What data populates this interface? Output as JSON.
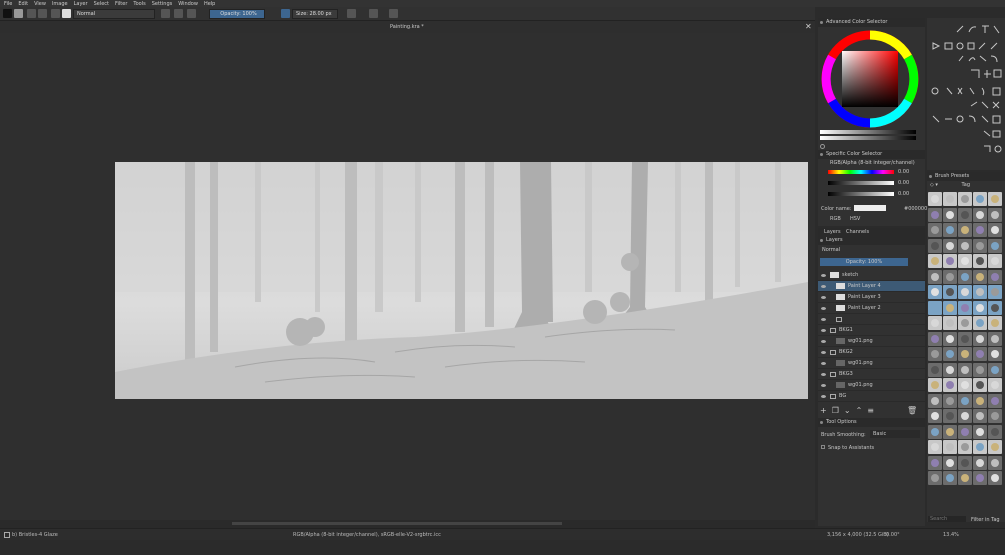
{
  "menu": [
    "File",
    "Edit",
    "View",
    "Image",
    "Layer",
    "Select",
    "Filter",
    "Tools",
    "Settings",
    "Window",
    "Help"
  ],
  "toolbar": {
    "blend_mode": "Normal",
    "opacity": "Opacity: 100%",
    "size": "Size: 28.00 px"
  },
  "document": {
    "tab_title": "Painting.kra *"
  },
  "status": {
    "brush": "b) Bristles-4 Glaze",
    "color_space": "RGB/Alpha (8-bit integer/channel), sRGB-elle-V2-srgbtrc.icc",
    "dimensions": "3,156 x 4,000 (32.5 GiB)",
    "rotation": "0.00°",
    "zoom": "13.4%"
  },
  "dockers": {
    "advanced_color": "Advanced Color Selector",
    "specific_color": {
      "title": "Specific Color Selector",
      "profile": "RGB/Alpha (8-bit integer/channel)",
      "values": [
        "0.00",
        "0.00",
        "0.00"
      ],
      "color_name_label": "Color name:",
      "hex": "#000000",
      "mode": "RGB",
      "hsv": "HSV"
    },
    "layers_tabs": [
      "Layers",
      "Channels"
    ],
    "layers": {
      "title": "Layers",
      "blend": "Normal",
      "opacity": "Opacity: 100%",
      "items": [
        {
          "name": "sketch",
          "type": "layer",
          "selected": false,
          "indent": 0
        },
        {
          "name": "Paint Layer 4",
          "type": "layer",
          "selected": true,
          "indent": 1
        },
        {
          "name": "Paint Layer 3",
          "type": "layer",
          "selected": false,
          "indent": 1
        },
        {
          "name": "Paint Layer 2",
          "type": "layer",
          "selected": false,
          "indent": 1
        },
        {
          "name": "",
          "type": "folder",
          "selected": false,
          "indent": 1
        },
        {
          "name": "BKG1",
          "type": "folder",
          "selected": false,
          "indent": 0
        },
        {
          "name": "wg01.png",
          "type": "layer",
          "selected": false,
          "indent": 1
        },
        {
          "name": "BKG2",
          "type": "folder",
          "selected": false,
          "indent": 0
        },
        {
          "name": "wg01.png",
          "type": "layer",
          "selected": false,
          "indent": 1
        },
        {
          "name": "BKG3",
          "type": "folder",
          "selected": false,
          "indent": 0
        },
        {
          "name": "wg01.png",
          "type": "layer",
          "selected": false,
          "indent": 1
        },
        {
          "name": "BG",
          "type": "folder",
          "selected": false,
          "indent": 0
        }
      ]
    },
    "tool_options": {
      "title": "Tool Options",
      "smoothing_label": "Brush Smoothing:",
      "smoothing": "Basic",
      "snap": "Snap to Assistants"
    },
    "brush_presets": {
      "title": "Brush Presets",
      "tag": "Tag",
      "search_placeholder": "Search",
      "filter": "Filter in Tag"
    }
  },
  "colors": {
    "accent": "#3d5a75",
    "bg": "#2b2b2b",
    "panel": "#313131"
  }
}
